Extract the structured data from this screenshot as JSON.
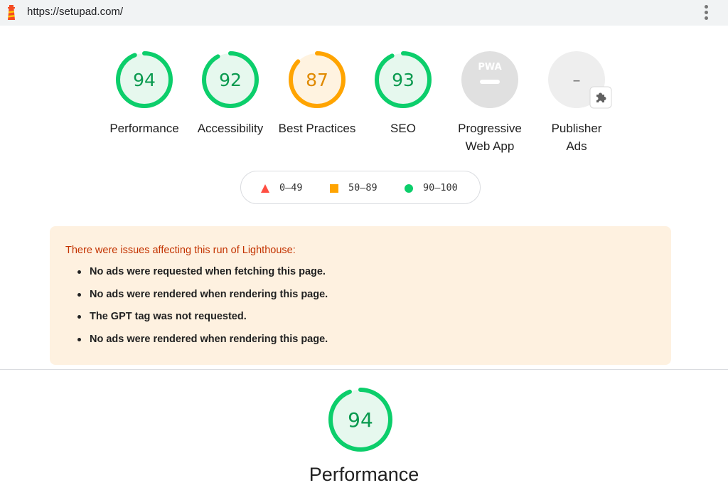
{
  "address_bar": {
    "url": "https://setupad.com/",
    "logo_icon": "lighthouse-icon",
    "menu_icon": "more-vert-icon"
  },
  "gauges": [
    {
      "label": "Performance",
      "score": "94",
      "status": "pass"
    },
    {
      "label": "Accessibility",
      "score": "92",
      "status": "pass"
    },
    {
      "label": "Best Practices",
      "score": "87",
      "status": "average"
    },
    {
      "label": "SEO",
      "score": "93",
      "status": "pass"
    },
    {
      "label": "Progressive Web App",
      "badge": "PWA",
      "status": "pwa"
    },
    {
      "label": "Publisher Ads",
      "score": "–",
      "status": "plugin",
      "badge_icon": "puzzle-icon"
    }
  ],
  "legend": {
    "fail": "0–49",
    "average": "50–89",
    "pass": "90–100"
  },
  "warning": {
    "title": "There were issues affecting this run of Lighthouse:",
    "items": [
      "No ads were requested when fetching this page.",
      "No ads were rendered when rendering this page.",
      "The GPT tag was not requested.",
      "No ads were rendered when rendering this page."
    ]
  },
  "section": {
    "title": "Performance",
    "score": "94"
  },
  "colors": {
    "pass": "#0cce6b",
    "pass_text": "#008800",
    "pass_fill": "#e6f8ee",
    "average": "#ffa400",
    "average_text": "#c33300",
    "average_fill": "#fff3e0",
    "fail": "#ff4e42",
    "neutral": "#e0e0e0",
    "warning_bg": "#fef1e0",
    "warning_text": "#c33300"
  }
}
